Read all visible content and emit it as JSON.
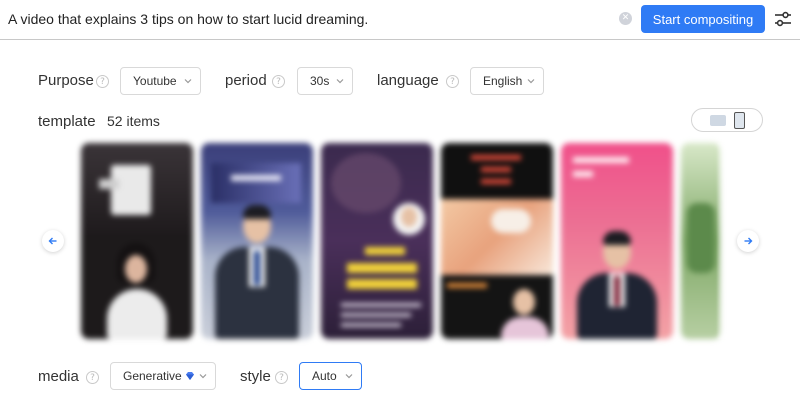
{
  "prompt": {
    "value": "A video that explains 3 tips on how to start lucid dreaming.",
    "clear_glyph": "✕",
    "start_label": "Start compositing"
  },
  "options": {
    "purpose": {
      "label": "Purpose",
      "value": "Youtube"
    },
    "period": {
      "label": "period",
      "value": "30s"
    },
    "language": {
      "label": "language",
      "value": "English"
    },
    "media": {
      "label": "media",
      "value": "Generative"
    },
    "style": {
      "label": "style",
      "value": "Auto"
    },
    "help_glyph": "?"
  },
  "template": {
    "label": "template",
    "count": "52 items"
  },
  "colors": {
    "primary": "#2f7bf5",
    "border": "#d9d9d9"
  },
  "icons": {
    "settings": "sliders-icon",
    "prev": "arrow-left-icon",
    "next": "arrow-right-icon",
    "gem": "gem-icon"
  }
}
